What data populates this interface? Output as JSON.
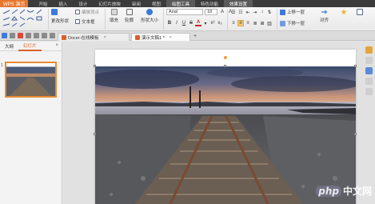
{
  "app": {
    "name": "WPS 演示",
    "menu": [
      "开始",
      "插入",
      "设计",
      "幻灯片放映",
      "审阅",
      "视图",
      "绘图工具",
      "特色功能",
      "效果设置"
    ],
    "highlight_index": 6
  },
  "ribbon": {
    "change_shape": "更改形状",
    "text_box": "文本框",
    "fill": "填充",
    "outline": "轮廓",
    "shape_size": "形状大小",
    "font": "Arial",
    "font_size": "18",
    "bring_forward": "上移一层",
    "send_backward": "下移一层",
    "align": "对齐",
    "edit_vertex": "编辑顶点",
    "font_color_letter": "A",
    "bold": "B",
    "italic": "I",
    "underline": "U",
    "strike": "S"
  },
  "tabs": [
    {
      "label": "Docer-在线模板",
      "active": false
    },
    {
      "label": "演示文稿1 *",
      "active": true
    }
  ],
  "left_panel": {
    "tab_outline": "大纲",
    "tab_slides": "幻灯片",
    "slide_number": "1"
  },
  "watermark": {
    "logo": "php",
    "text": "中文网"
  }
}
